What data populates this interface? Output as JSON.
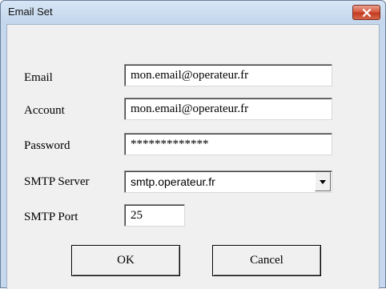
{
  "window": {
    "title": "Email Set"
  },
  "form": {
    "email_label": "Email",
    "email_value": "mon.email@operateur.fr",
    "account_label": "Account",
    "account_value": "mon.email@operateur.fr",
    "password_label": "Password",
    "password_value": "*************",
    "smtp_server_label": "SMTP Server",
    "smtp_server_value": "smtp.operateur.fr",
    "smtp_port_label": "SMTP Port",
    "smtp_port_value": "25"
  },
  "buttons": {
    "ok_label": "OK",
    "cancel_label": "Cancel"
  },
  "icons": {
    "close": "close-icon",
    "dropdown": "chevron-down-icon"
  }
}
